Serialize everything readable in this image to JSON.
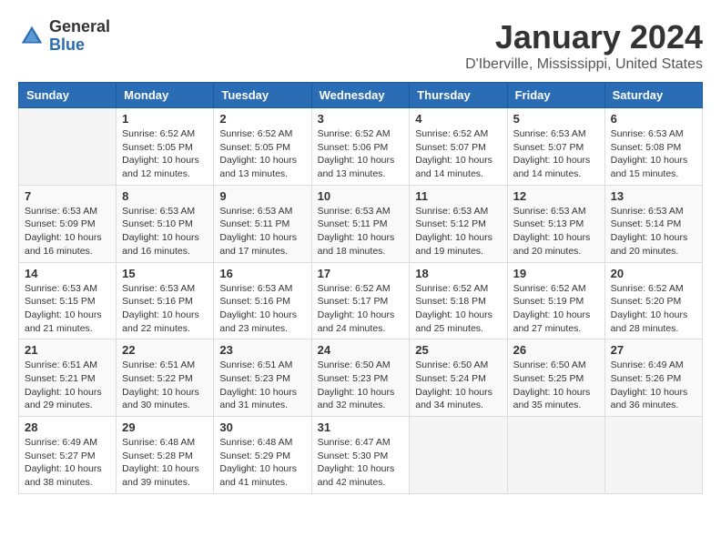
{
  "header": {
    "logo_general": "General",
    "logo_blue": "Blue",
    "month_title": "January 2024",
    "location": "D'Iberville, Mississippi, United States"
  },
  "weekdays": [
    "Sunday",
    "Monday",
    "Tuesday",
    "Wednesday",
    "Thursday",
    "Friday",
    "Saturday"
  ],
  "weeks": [
    [
      {
        "day": "",
        "sunrise": "",
        "sunset": "",
        "daylight": ""
      },
      {
        "day": "1",
        "sunrise": "Sunrise: 6:52 AM",
        "sunset": "Sunset: 5:05 PM",
        "daylight": "Daylight: 10 hours and 12 minutes."
      },
      {
        "day": "2",
        "sunrise": "Sunrise: 6:52 AM",
        "sunset": "Sunset: 5:05 PM",
        "daylight": "Daylight: 10 hours and 13 minutes."
      },
      {
        "day": "3",
        "sunrise": "Sunrise: 6:52 AM",
        "sunset": "Sunset: 5:06 PM",
        "daylight": "Daylight: 10 hours and 13 minutes."
      },
      {
        "day": "4",
        "sunrise": "Sunrise: 6:52 AM",
        "sunset": "Sunset: 5:07 PM",
        "daylight": "Daylight: 10 hours and 14 minutes."
      },
      {
        "day": "5",
        "sunrise": "Sunrise: 6:53 AM",
        "sunset": "Sunset: 5:07 PM",
        "daylight": "Daylight: 10 hours and 14 minutes."
      },
      {
        "day": "6",
        "sunrise": "Sunrise: 6:53 AM",
        "sunset": "Sunset: 5:08 PM",
        "daylight": "Daylight: 10 hours and 15 minutes."
      }
    ],
    [
      {
        "day": "7",
        "sunrise": "Sunrise: 6:53 AM",
        "sunset": "Sunset: 5:09 PM",
        "daylight": "Daylight: 10 hours and 16 minutes."
      },
      {
        "day": "8",
        "sunrise": "Sunrise: 6:53 AM",
        "sunset": "Sunset: 5:10 PM",
        "daylight": "Daylight: 10 hours and 16 minutes."
      },
      {
        "day": "9",
        "sunrise": "Sunrise: 6:53 AM",
        "sunset": "Sunset: 5:11 PM",
        "daylight": "Daylight: 10 hours and 17 minutes."
      },
      {
        "day": "10",
        "sunrise": "Sunrise: 6:53 AM",
        "sunset": "Sunset: 5:11 PM",
        "daylight": "Daylight: 10 hours and 18 minutes."
      },
      {
        "day": "11",
        "sunrise": "Sunrise: 6:53 AM",
        "sunset": "Sunset: 5:12 PM",
        "daylight": "Daylight: 10 hours and 19 minutes."
      },
      {
        "day": "12",
        "sunrise": "Sunrise: 6:53 AM",
        "sunset": "Sunset: 5:13 PM",
        "daylight": "Daylight: 10 hours and 20 minutes."
      },
      {
        "day": "13",
        "sunrise": "Sunrise: 6:53 AM",
        "sunset": "Sunset: 5:14 PM",
        "daylight": "Daylight: 10 hours and 20 minutes."
      }
    ],
    [
      {
        "day": "14",
        "sunrise": "Sunrise: 6:53 AM",
        "sunset": "Sunset: 5:15 PM",
        "daylight": "Daylight: 10 hours and 21 minutes."
      },
      {
        "day": "15",
        "sunrise": "Sunrise: 6:53 AM",
        "sunset": "Sunset: 5:16 PM",
        "daylight": "Daylight: 10 hours and 22 minutes."
      },
      {
        "day": "16",
        "sunrise": "Sunrise: 6:53 AM",
        "sunset": "Sunset: 5:16 PM",
        "daylight": "Daylight: 10 hours and 23 minutes."
      },
      {
        "day": "17",
        "sunrise": "Sunrise: 6:52 AM",
        "sunset": "Sunset: 5:17 PM",
        "daylight": "Daylight: 10 hours and 24 minutes."
      },
      {
        "day": "18",
        "sunrise": "Sunrise: 6:52 AM",
        "sunset": "Sunset: 5:18 PM",
        "daylight": "Daylight: 10 hours and 25 minutes."
      },
      {
        "day": "19",
        "sunrise": "Sunrise: 6:52 AM",
        "sunset": "Sunset: 5:19 PM",
        "daylight": "Daylight: 10 hours and 27 minutes."
      },
      {
        "day": "20",
        "sunrise": "Sunrise: 6:52 AM",
        "sunset": "Sunset: 5:20 PM",
        "daylight": "Daylight: 10 hours and 28 minutes."
      }
    ],
    [
      {
        "day": "21",
        "sunrise": "Sunrise: 6:51 AM",
        "sunset": "Sunset: 5:21 PM",
        "daylight": "Daylight: 10 hours and 29 minutes."
      },
      {
        "day": "22",
        "sunrise": "Sunrise: 6:51 AM",
        "sunset": "Sunset: 5:22 PM",
        "daylight": "Daylight: 10 hours and 30 minutes."
      },
      {
        "day": "23",
        "sunrise": "Sunrise: 6:51 AM",
        "sunset": "Sunset: 5:23 PM",
        "daylight": "Daylight: 10 hours and 31 minutes."
      },
      {
        "day": "24",
        "sunrise": "Sunrise: 6:50 AM",
        "sunset": "Sunset: 5:23 PM",
        "daylight": "Daylight: 10 hours and 32 minutes."
      },
      {
        "day": "25",
        "sunrise": "Sunrise: 6:50 AM",
        "sunset": "Sunset: 5:24 PM",
        "daylight": "Daylight: 10 hours and 34 minutes."
      },
      {
        "day": "26",
        "sunrise": "Sunrise: 6:50 AM",
        "sunset": "Sunset: 5:25 PM",
        "daylight": "Daylight: 10 hours and 35 minutes."
      },
      {
        "day": "27",
        "sunrise": "Sunrise: 6:49 AM",
        "sunset": "Sunset: 5:26 PM",
        "daylight": "Daylight: 10 hours and 36 minutes."
      }
    ],
    [
      {
        "day": "28",
        "sunrise": "Sunrise: 6:49 AM",
        "sunset": "Sunset: 5:27 PM",
        "daylight": "Daylight: 10 hours and 38 minutes."
      },
      {
        "day": "29",
        "sunrise": "Sunrise: 6:48 AM",
        "sunset": "Sunset: 5:28 PM",
        "daylight": "Daylight: 10 hours and 39 minutes."
      },
      {
        "day": "30",
        "sunrise": "Sunrise: 6:48 AM",
        "sunset": "Sunset: 5:29 PM",
        "daylight": "Daylight: 10 hours and 41 minutes."
      },
      {
        "day": "31",
        "sunrise": "Sunrise: 6:47 AM",
        "sunset": "Sunset: 5:30 PM",
        "daylight": "Daylight: 10 hours and 42 minutes."
      },
      {
        "day": "",
        "sunrise": "",
        "sunset": "",
        "daylight": ""
      },
      {
        "day": "",
        "sunrise": "",
        "sunset": "",
        "daylight": ""
      },
      {
        "day": "",
        "sunrise": "",
        "sunset": "",
        "daylight": ""
      }
    ]
  ]
}
